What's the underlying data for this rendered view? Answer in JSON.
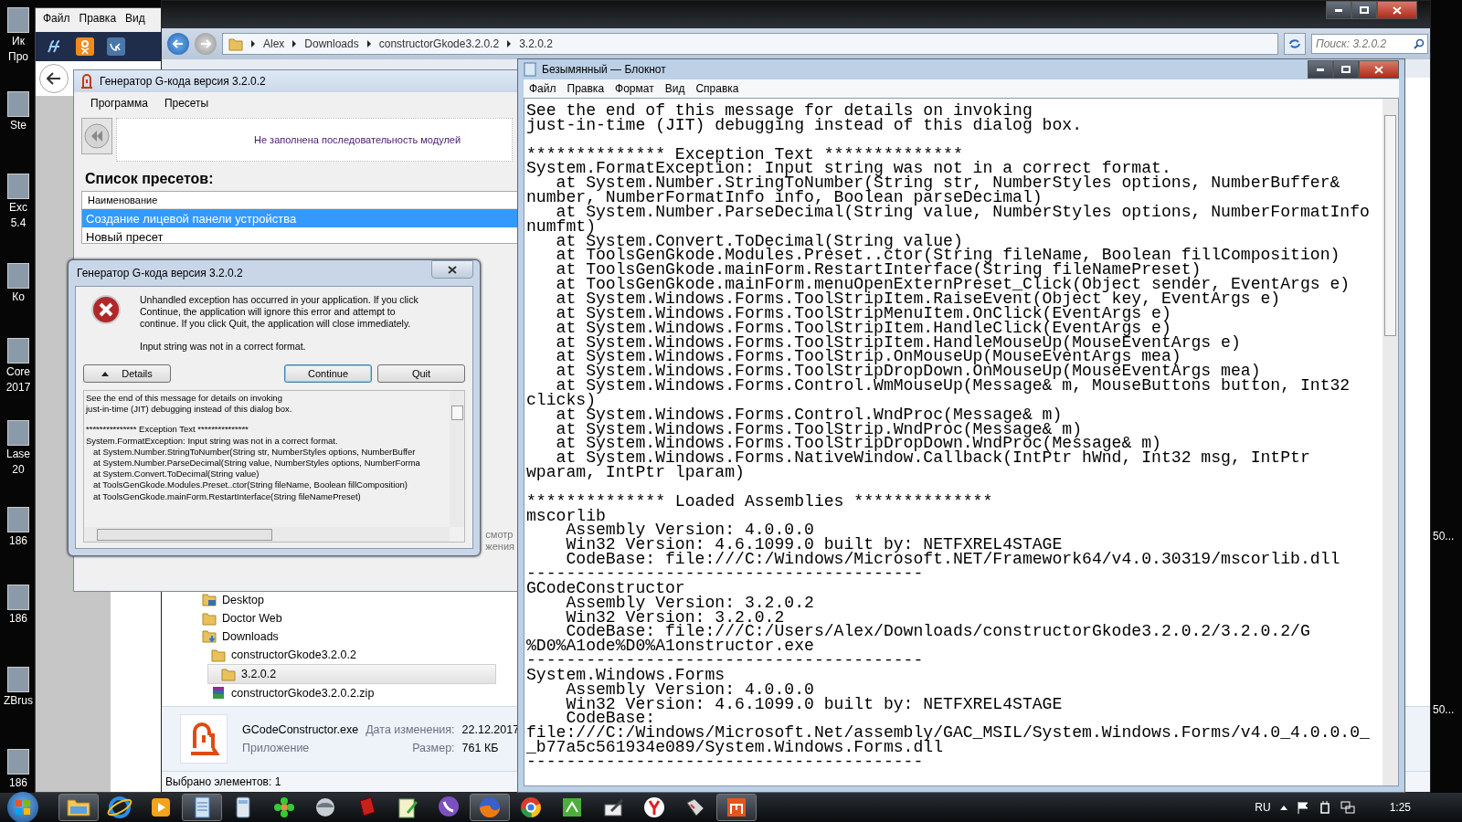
{
  "desktop": {
    "left_icons": [
      {
        "lines": [
          "Ик",
          "Про"
        ]
      },
      {
        "lines": [
          "Ste"
        ]
      },
      {
        "lines": [
          "Exc",
          "5.4"
        ]
      },
      {
        "lines": [
          "Ко"
        ]
      },
      {
        "lines": [
          "Core",
          "2017"
        ]
      },
      {
        "lines": [
          "Lase",
          "20"
        ]
      },
      {
        "lines": [
          "186"
        ]
      },
      {
        "lines": [
          "186"
        ]
      },
      {
        "lines": [
          "ZBrus"
        ]
      },
      {
        "lines": [
          "186"
        ]
      }
    ],
    "right_icons": [
      {
        "lines": [
          "50..."
        ]
      },
      {
        "lines": [
          "50..."
        ]
      }
    ]
  },
  "browser": {
    "menu": [
      "Файл",
      "Правка",
      "Вид"
    ],
    "toolbar_icons": [
      {
        "kind": "script"
      },
      {
        "kind": "ok"
      },
      {
        "kind": "vk"
      }
    ]
  },
  "explorer": {
    "breadcrumbs": [
      "Alex",
      "Downloads",
      "constructorGkode3.2.0.2",
      "3.2.0.2"
    ],
    "search": {
      "placeholder": "Поиск: 3.2.0.2"
    },
    "tree": [
      {
        "label": "Desktop",
        "kind": "desktop",
        "selected": false
      },
      {
        "label": "Doctor Web",
        "kind": "folder",
        "selected": false
      },
      {
        "label": "Downloads",
        "kind": "downloads",
        "selected": false,
        "children": [
          {
            "label": "constructorGkode3.2.0.2",
            "kind": "folder",
            "selected": false,
            "children": [
              {
                "label": "3.2.0.2",
                "kind": "folder",
                "selected": true
              }
            ]
          },
          {
            "label": "constructorGkode3.2.0.2.zip",
            "kind": "archive",
            "selected": false
          }
        ]
      }
    ],
    "details": {
      "file_name": "GCodeConstructor.exe",
      "date_label": "Дата изменения:",
      "date": "22.12.2017",
      "type": "Приложение",
      "size_label": "Размер:",
      "size": "761 КБ"
    },
    "status_bar": "Выбрано элементов: 1"
  },
  "generator": {
    "title": "Генератор G-кода версия 3.2.0.2",
    "menu": [
      "Программа",
      "Пресеты"
    ],
    "status": "Не заполнена последовательность модулей",
    "list_title": "Список пресетов:",
    "column": "Наименование",
    "presets": [
      {
        "name": "Создание лицевой панели устройства",
        "selected": true
      },
      {
        "name": "Новый пресет",
        "selected": false
      }
    ],
    "covered_button_lines": [
      "смотр",
      "жения"
    ]
  },
  "dialog": {
    "title": "Генератор G-кода версия 3.2.0.2",
    "message": "Unhandled exception has occurred in your application. If you click Continue, the application will ignore this error and attempt to continue. If you click Quit, the application will close immediately.",
    "error": "Input string was not in a correct format.",
    "buttons": {
      "details": "Details",
      "continue": "Continue",
      "quit": "Quit"
    },
    "details_lines": [
      "See the end of this message for details on invoking",
      "just-in-time (JIT) debugging instead of this dialog box.",
      "*************** Exception Text ***************",
      "System.FormatException: Input string was not in a correct format.",
      "   at System.Number.StringToNumber(String str, NumberStyles options, NumberBuffer",
      "   at System.Number.ParseDecimal(String value, NumberStyles options, NumberForma",
      "   at System.Convert.ToDecimal(String value)",
      "   at ToolsGenGkode.Modules.Preset..ctor(String fileName, Boolean fillComposition)",
      "   at ToolsGenGkode.mainForm.RestartInterface(String fileNamePreset)"
    ]
  },
  "notepad": {
    "title": "Безымянный — Блокнот",
    "menu": [
      "Файл",
      "Правка",
      "Формат",
      "Вид",
      "Справка"
    ],
    "blocks": [
      [
        "See the end of this message for details on invoking",
        "just-in-time (JIT) debugging instead of this dialog box."
      ],
      [
        "************** Exception Text **************",
        "System.FormatException: Input string was not in a correct format.",
        "   at System.Number.StringToNumber(String str, NumberStyles options, NumberBuffer&",
        "number, NumberFormatInfo info, Boolean parseDecimal)",
        "   at System.Number.ParseDecimal(String value, NumberStyles options, NumberFormatInfo",
        "numfmt)",
        "   at System.Convert.ToDecimal(String value)",
        "   at ToolsGenGkode.Modules.Preset..ctor(String fileName, Boolean fillComposition)",
        "   at ToolsGenGkode.mainForm.RestartInterface(String fileNamePreset)",
        "   at ToolsGenGkode.mainForm.menuOpenExternPreset_Click(Object sender, EventArgs e)",
        "   at System.Windows.Forms.ToolStripItem.RaiseEvent(Object key, EventArgs e)",
        "   at System.Windows.Forms.ToolStripMenuItem.OnClick(EventArgs e)",
        "   at System.Windows.Forms.ToolStripItem.HandleClick(EventArgs e)",
        "   at System.Windows.Forms.ToolStripItem.HandleMouseUp(MouseEventArgs e)",
        "   at System.Windows.Forms.ToolStrip.OnMouseUp(MouseEventArgs mea)",
        "   at System.Windows.Forms.ToolStripDropDown.OnMouseUp(MouseEventArgs mea)",
        "   at System.Windows.Forms.Control.WmMouseUp(Message& m, MouseButtons button, Int32",
        "clicks)",
        "   at System.Windows.Forms.Control.WndProc(Message& m)",
        "   at System.Windows.Forms.ToolStrip.WndProc(Message& m)",
        "   at System.Windows.Forms.ToolStripDropDown.WndProc(Message& m)",
        "   at System.Windows.Forms.NativeWindow.Callback(IntPtr hWnd, Int32 msg, IntPtr",
        "wparam, IntPtr lparam)"
      ],
      [
        "************** Loaded Assemblies **************",
        "mscorlib",
        "    Assembly Version: 4.0.0.0",
        "    Win32 Version: 4.6.1099.0 built by: NETFXREL4STAGE",
        "    CodeBase: file:///C:/Windows/Microsoft.NET/Framework64/v4.0.30319/mscorlib.dll",
        "----------------------------------------",
        "GCodeConstructor",
        "    Assembly Version: 3.2.0.2",
        "    Win32 Version: 3.2.0.2",
        "    CodeBase: file:///C:/Users/Alex/Downloads/constructorGkode3.2.0.2/3.2.0.2/G",
        "%D0%A1ode%D0%A1onstructor.exe",
        "----------------------------------------",
        "System.Windows.Forms",
        "    Assembly Version: 4.0.0.0",
        "    Win32 Version: 4.6.1099.0 built by: NETFXREL4STAGE",
        "    CodeBase:",
        "file:///C:/Windows/Microsoft.Net/assembly/GAC_MSIL/System.Windows.Forms/v4.0_4.0.0.0_",
        "_b77a5c561934e089/System.Windows.Forms.dll",
        "----------------------------------------"
      ]
    ]
  },
  "taskbar": {
    "items": [
      {
        "kind": "folder",
        "open": true
      },
      {
        "kind": "ie",
        "open": false
      },
      {
        "kind": "media",
        "open": false
      },
      {
        "kind": "notepad",
        "open": true
      },
      {
        "kind": "calculator",
        "open": false
      },
      {
        "kind": "flower",
        "open": false
      },
      {
        "kind": "sphere",
        "open": false
      },
      {
        "kind": "book",
        "open": false
      },
      {
        "kind": "notepen",
        "open": false
      },
      {
        "kind": "viber",
        "open": false
      },
      {
        "kind": "firefox",
        "open": true
      },
      {
        "kind": "chrome",
        "open": false
      },
      {
        "kind": "greenapp",
        "open": false
      },
      {
        "kind": "pen",
        "open": false
      },
      {
        "kind": "yandex",
        "open": false
      },
      {
        "kind": "tool",
        "open": false
      },
      {
        "kind": "gcode",
        "open": true
      }
    ],
    "language": "RU",
    "clock": "1:25"
  }
}
